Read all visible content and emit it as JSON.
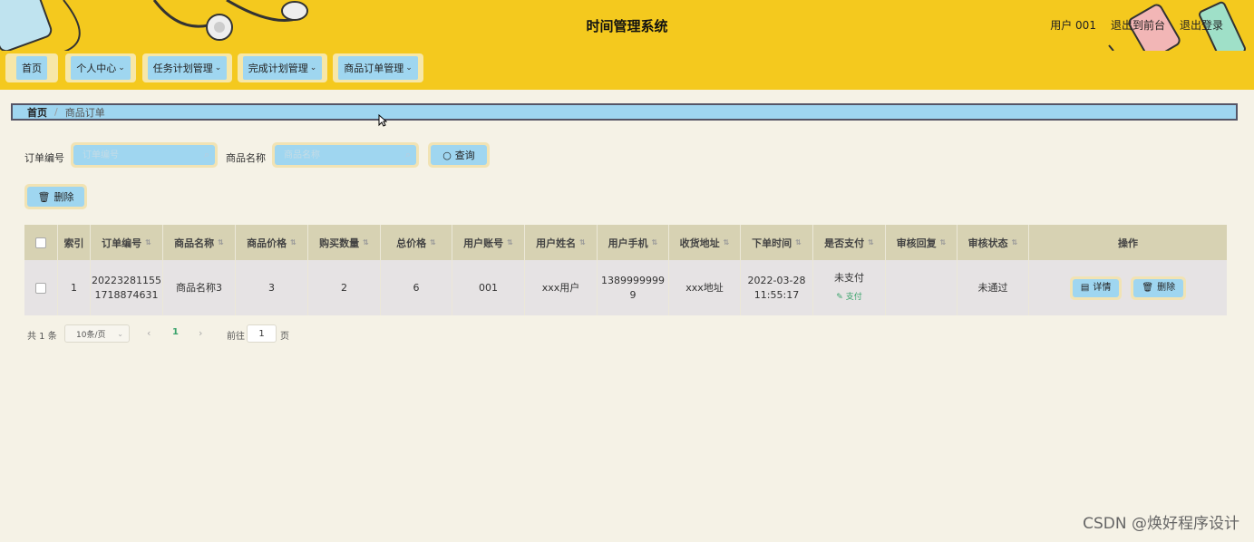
{
  "header": {
    "title": "时间管理系统",
    "user_label": "用户 001",
    "back_to_front": "退出到前台",
    "logout": "退出登录"
  },
  "nav": {
    "items": [
      {
        "label": "首页",
        "has_dropdown": false
      },
      {
        "label": "个人中心",
        "has_dropdown": true
      },
      {
        "label": "任务计划管理",
        "has_dropdown": true
      },
      {
        "label": "完成计划管理",
        "has_dropdown": true
      },
      {
        "label": "商品订单管理",
        "has_dropdown": true
      }
    ]
  },
  "breadcrumb": {
    "home": "首页",
    "separator": "/",
    "current": "商品订单"
  },
  "search": {
    "order_no_label": "订单编号",
    "order_no_placeholder": "订单编号",
    "product_name_label": "商品名称",
    "product_name_placeholder": "商品名称",
    "query_button": "查询"
  },
  "actions": {
    "delete_button": "删除"
  },
  "table": {
    "headers": [
      "索引",
      "订单编号",
      "商品名称",
      "商品价格",
      "购买数量",
      "总价格",
      "用户账号",
      "用户姓名",
      "用户手机",
      "收货地址",
      "下单时间",
      "是否支付",
      "审核回复",
      "审核状态",
      "操作"
    ],
    "rows": [
      {
        "index": "1",
        "order_no_1": "20223281155",
        "order_no_2": "1718874631",
        "product_name": "商品名称3",
        "price": "3",
        "quantity": "2",
        "total": "6",
        "account": "001",
        "user_name": "xxx用户",
        "phone_1": "1389999999",
        "phone_2": "9",
        "address": "xxx地址",
        "time_1": "2022-03-28",
        "time_2": "11:55:17",
        "paid_status": "未支付",
        "pay_link": "支付",
        "review_reply": "",
        "review_status": "未通过",
        "detail_button": "详情",
        "delete_button": "删除"
      }
    ]
  },
  "pagination": {
    "total_text": "共 1 条",
    "page_size": "10条/页",
    "current_page": "1",
    "goto_label": "前往",
    "goto_value": "1",
    "page_suffix": "页"
  },
  "watermark": "CSDN @焕好程序设计",
  "colors": {
    "header_bg": "#f4c91e",
    "button_bg": "#9fd6f0",
    "page_bg": "#f5f2e6",
    "table_header_bg": "#d7d2b3"
  }
}
